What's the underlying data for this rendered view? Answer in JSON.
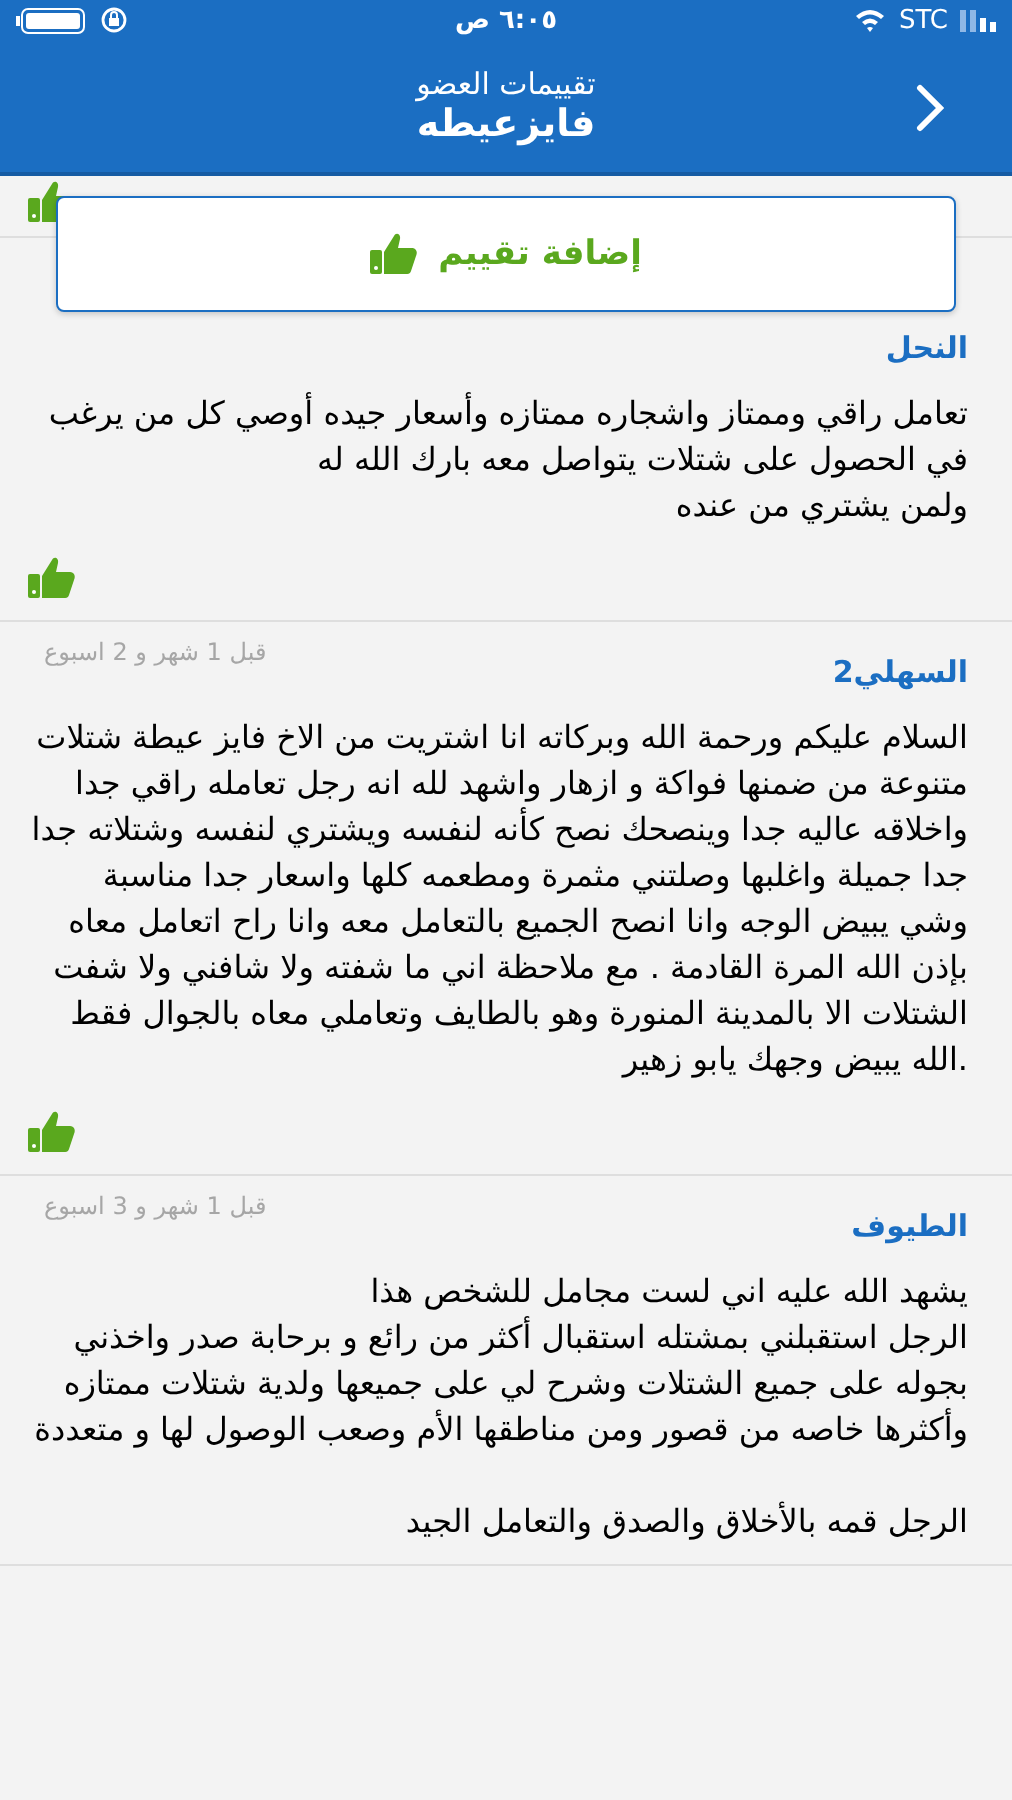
{
  "status_bar": {
    "carrier": "STC",
    "time": "٦:٠٥ ص"
  },
  "header": {
    "subtitle": "تقييمات العضو",
    "title": "فايزعيطه"
  },
  "add_button": {
    "label": "إضافة تقييم"
  },
  "previous_review": {
    "liked": true
  },
  "reviews": [
    {
      "author": "النحل",
      "text": "تعامل راقي وممتاز واشجاره ممتازه وأسعار جيده  أوصي كل من يرغب في الحصول على  شتلات يتواصل معه بارك الله له\nولمن  يشتري من عنده",
      "liked": true
    },
    {
      "author": "السهلي2",
      "date": "قبل 1 شهر و 2 اسبوع",
      "text": "السلام عليكم ورحمة الله وبركاته انا اشتريت من الاخ فايز عيطة شتلات متنوعة من ضمنها فواكة و ازهار واشهد لله انه رجل تعامله راقي جدا واخلاقه عاليه جدا وينصحك نصح كأنه لنفسه ويشتري لنفسه وشتلاته جدا جدا جميلة واغلبها وصلتني مثمرة ومطعمه كلها واسعار جدا مناسبة وشي يبيض الوجه وانا انصح الجميع بالتعامل معه وانا راح اتعامل معاه بإذن الله المرة القادمة . مع ملاحظة اني ما شفته ولا شافني ولا شفت الشتلات الا بالمدينة المنورة وهو بالطايف وتعاملي معاه بالجوال فقط .الله يبيض وجهك يابو زهير",
      "liked": true
    },
    {
      "author": "الطيوف",
      "date": "قبل 1 شهر و 3 اسبوع",
      "text": "يشهد الله عليه اني لست مجامل للشخص هذا\nالرجل استقبلني بمشتله استقبال أكثر من رائع و برحابة صدر واخذني بجوله على جميع الشتلات وشرح لي على جميعها ولدية شتلات ممتازه وأكثرها خاصه من قصور ومن مناطقها الأم وصعب الوصول لها و متعددة\n\nالرجل قمه بالأخلاق والصدق والتعامل الجيد"
    }
  ]
}
